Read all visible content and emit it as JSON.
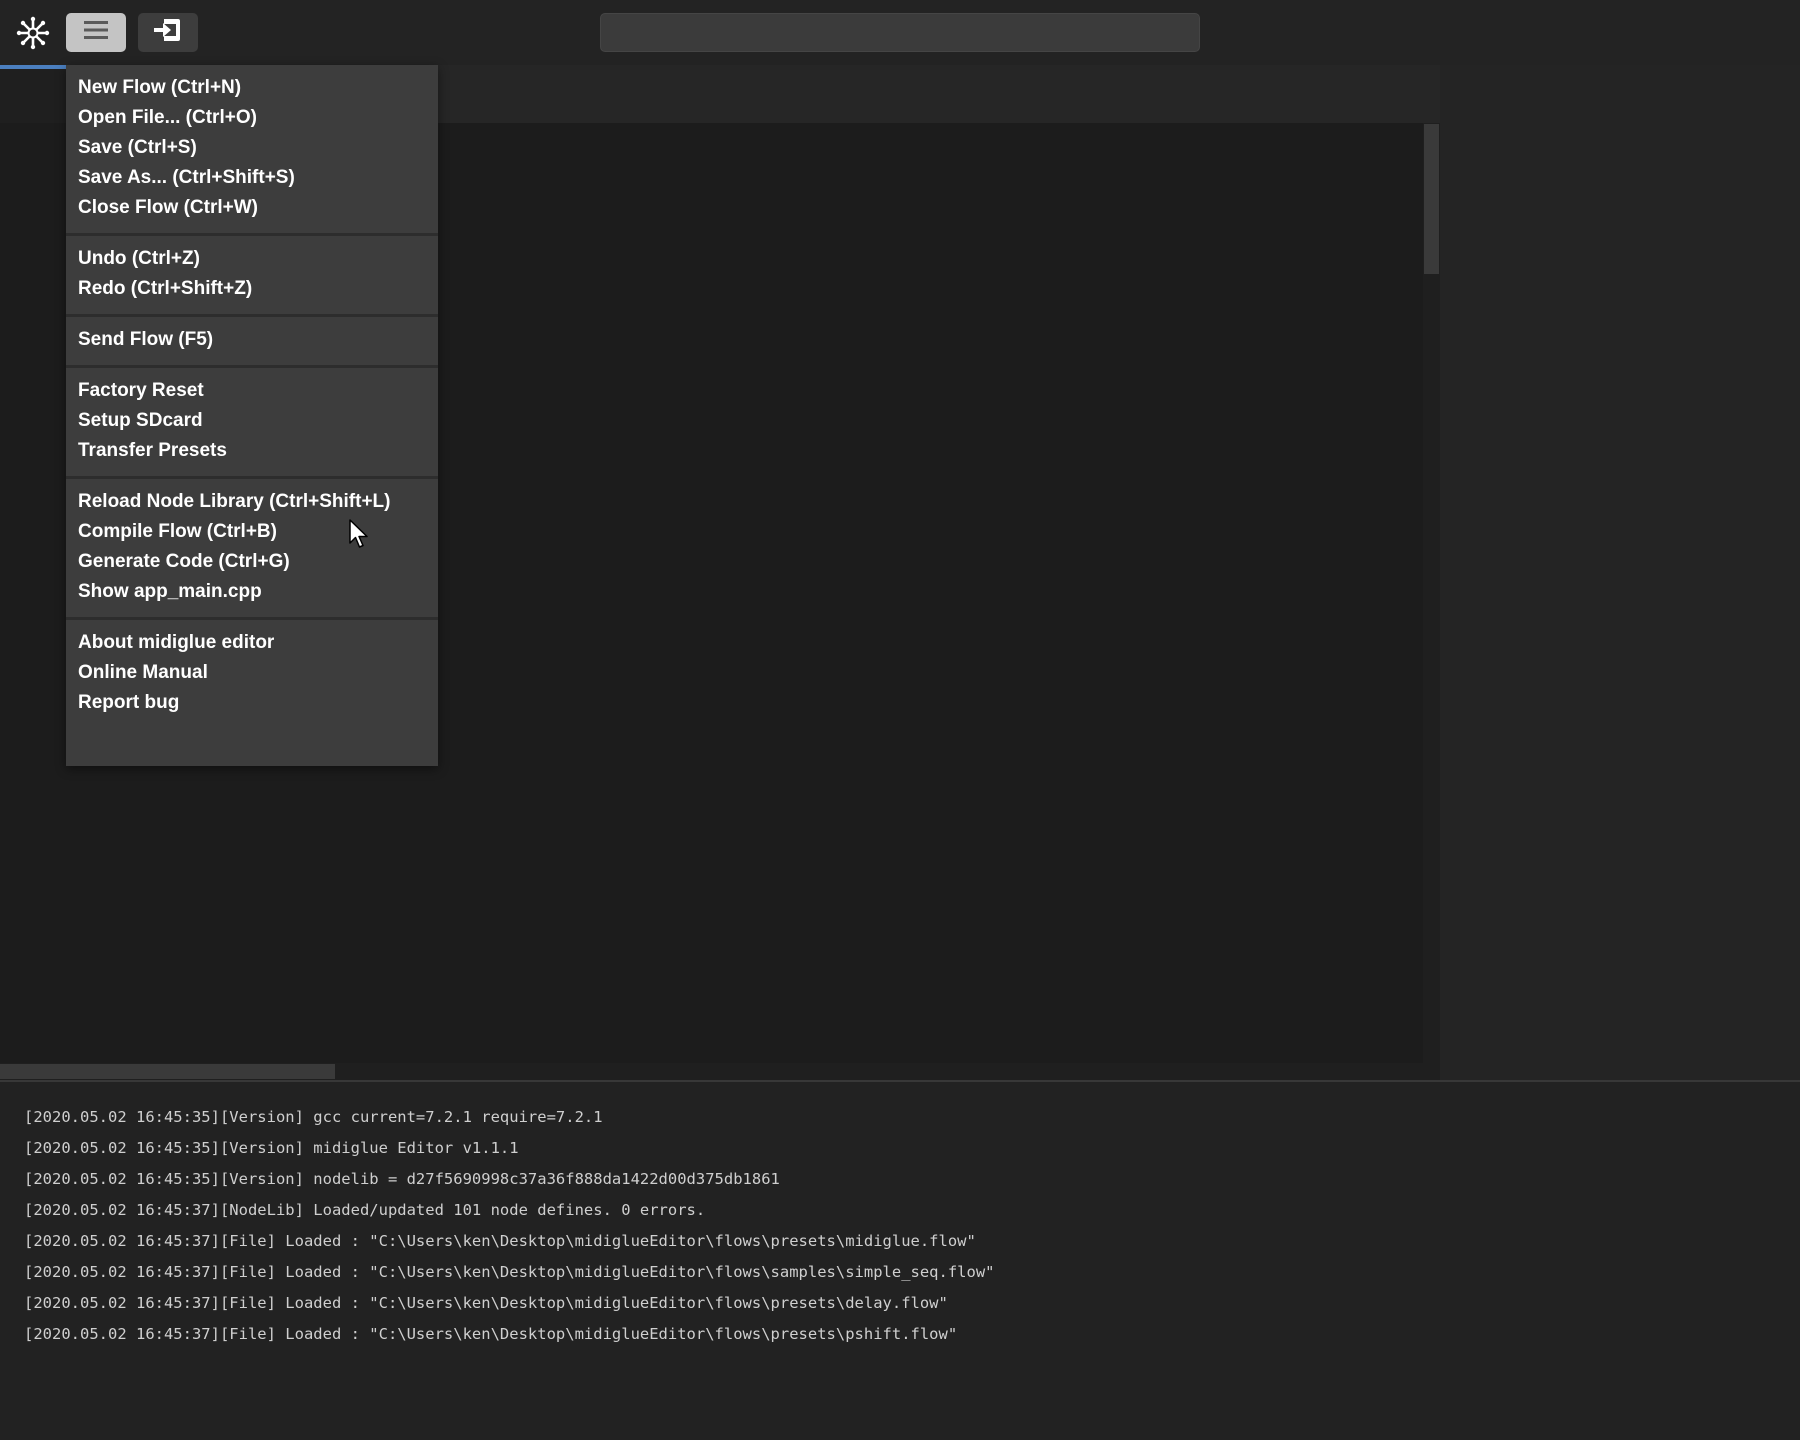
{
  "toolbar": {
    "logo_icon": "asterisk-logo-icon",
    "menu_button_icon": "hamburger-menu-icon",
    "export_button_icon": "sign-in-box-icon",
    "search": {
      "placeholder": "",
      "value": ""
    }
  },
  "menu": {
    "groups": [
      {
        "items": [
          {
            "label": "New Flow (Ctrl+N)"
          },
          {
            "label": "Open File... (Ctrl+O)"
          },
          {
            "label": "Save (Ctrl+S)"
          },
          {
            "label": "Save As... (Ctrl+Shift+S)"
          },
          {
            "label": "Close Flow (Ctrl+W)"
          }
        ]
      },
      {
        "items": [
          {
            "label": "Undo (Ctrl+Z)"
          },
          {
            "label": "Redo (Ctrl+Shift+Z)"
          }
        ]
      },
      {
        "items": [
          {
            "label": "Send Flow (F5)"
          }
        ]
      },
      {
        "items": [
          {
            "label": "Factory Reset"
          },
          {
            "label": "Setup SDcard"
          },
          {
            "label": "Transfer Presets"
          }
        ]
      },
      {
        "items": [
          {
            "label": "Reload Node Library (Ctrl+Shift+L)"
          },
          {
            "label": "Compile Flow (Ctrl+B)"
          },
          {
            "label": "Generate Code (Ctrl+G)"
          },
          {
            "label": "Show app_main.cpp"
          }
        ]
      },
      {
        "items": [
          {
            "label": "About midiglue editor"
          },
          {
            "label": "Online Manual"
          },
          {
            "label": "Report bug"
          }
        ]
      }
    ]
  },
  "console": {
    "lines": [
      "[2020.05.02 16:45:35][Version] gcc current=7.2.1 require=7.2.1",
      "[2020.05.02 16:45:35][Version] midiglue Editor v1.1.1",
      "[2020.05.02 16:45:35][Version] nodelib = d27f5690998c37a36f888da1422d00d375db1861",
      "[2020.05.02 16:45:37][NodeLib] Loaded/updated 101 node defines. 0 errors.",
      "[2020.05.02 16:45:37][File] Loaded : \"C:\\Users\\ken\\Desktop\\midiglueEditor\\flows\\presets\\midiglue.flow\"",
      "[2020.05.02 16:45:37][File] Loaded : \"C:\\Users\\ken\\Desktop\\midiglueEditor\\flows\\samples\\simple_seq.flow\"",
      "[2020.05.02 16:45:37][File] Loaded : \"C:\\Users\\ken\\Desktop\\midiglueEditor\\flows\\presets\\delay.flow\"",
      "[2020.05.02 16:45:37][File] Loaded : \"C:\\Users\\ken\\Desktop\\midiglueEditor\\flows\\presets\\pshift.flow\""
    ]
  },
  "colors": {
    "background": "#1e1e1e",
    "menu_bg": "#3d3d3d",
    "accent": "#4b7fbf",
    "menu_button_active": "#c4c4c4"
  }
}
